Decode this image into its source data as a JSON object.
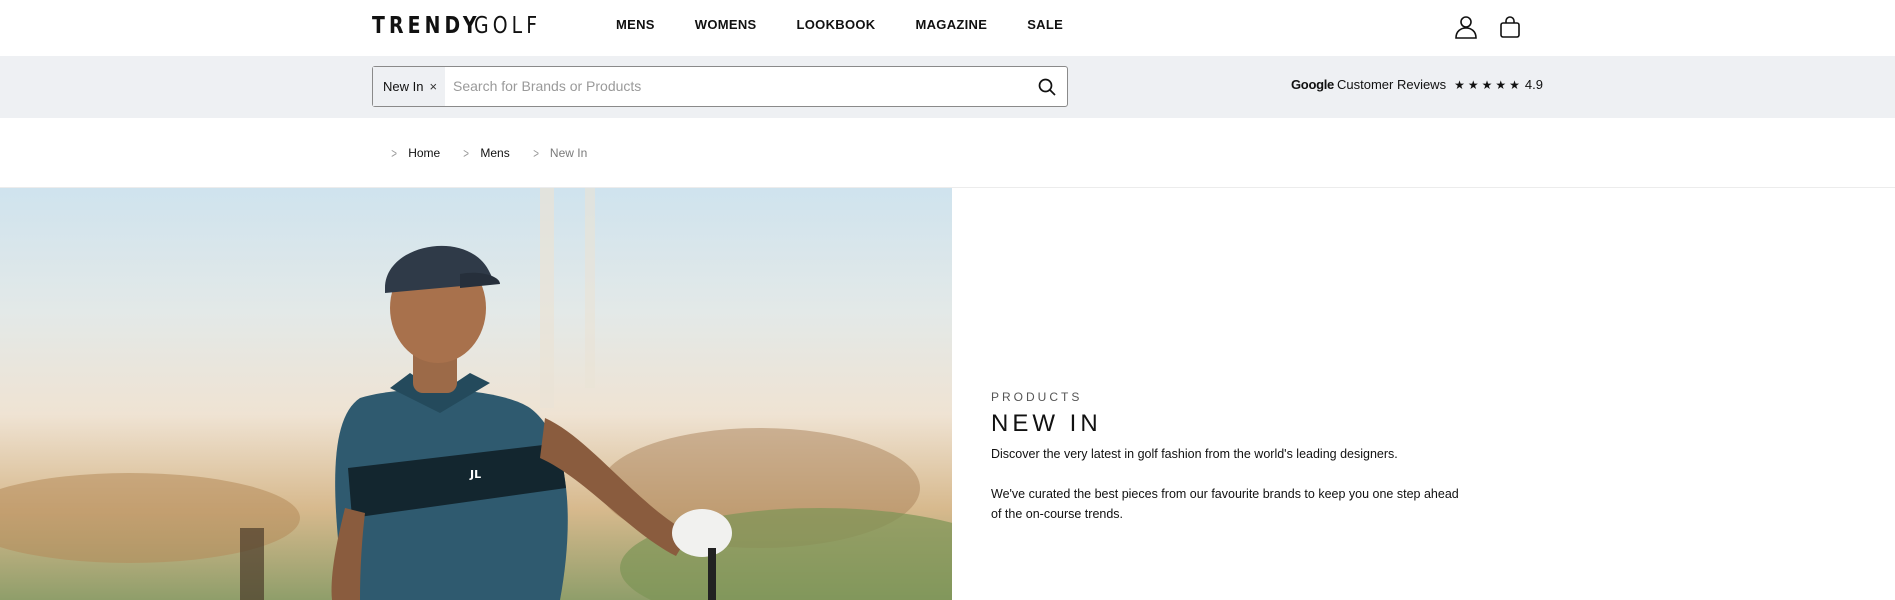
{
  "header": {
    "logo_part1": "TRENDY",
    "logo_part2": "GOLF",
    "nav": [
      "MENS",
      "WOMENS",
      "LOOKBOOK",
      "MAGAZINE",
      "SALE"
    ]
  },
  "search": {
    "chip_label": "New In",
    "chip_close": "×",
    "placeholder": "Search for Brands or Products",
    "value": ""
  },
  "reviews": {
    "brand": "Google",
    "label": "Customer Reviews",
    "stars": "★★★★★",
    "rating": "4.9"
  },
  "breadcrumb": [
    "Home",
    "Mens",
    "New In"
  ],
  "hero": {
    "eyebrow": "PRODUCTS",
    "title": "NEW IN",
    "description": "Discover the very latest in golf fashion from the world's leading designers.",
    "description2": "We've curated the best pieces from our favourite brands to keep you one step ahead of the on-course trends."
  },
  "colors": {
    "band_bg": "#eef0f3",
    "text": "#111111",
    "muted": "#7a7a7a"
  },
  "icons": [
    "user-icon",
    "bag-icon",
    "search-icon",
    "chevron-right-icon",
    "close-icon",
    "star-icon"
  ]
}
